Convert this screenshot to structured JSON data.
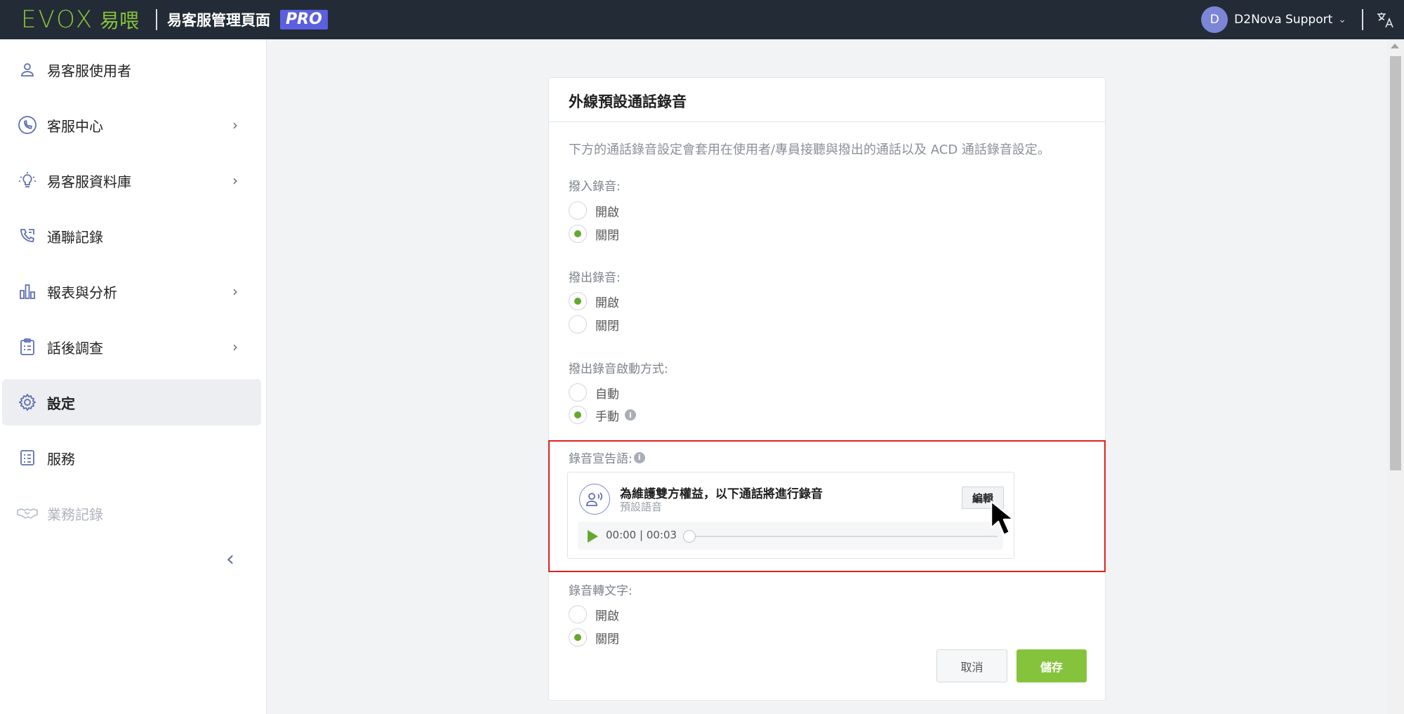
{
  "app": {
    "brand_logo_text": "EVOX",
    "brand_logo_cn": "易喂",
    "title": "易客服管理頁面",
    "badge": "PRO"
  },
  "user": {
    "avatar_letter": "D",
    "name": "D2Nova Support"
  },
  "sidebar": {
    "items": [
      {
        "label": "易客服使用者",
        "icon": "user-icon",
        "has_submenu": false
      },
      {
        "label": "客服中心",
        "icon": "call-center-icon",
        "has_submenu": true
      },
      {
        "label": "易客服資料庫",
        "icon": "lightbulb-icon",
        "has_submenu": true
      },
      {
        "label": "通聯記錄",
        "icon": "phone-log-icon",
        "has_submenu": false
      },
      {
        "label": "報表與分析",
        "icon": "bar-chart-icon",
        "has_submenu": true
      },
      {
        "label": "話後調查",
        "icon": "survey-icon",
        "has_submenu": true
      },
      {
        "label": "設定",
        "icon": "gear-icon",
        "has_submenu": false,
        "active": true
      },
      {
        "label": "服務",
        "icon": "service-list-icon",
        "has_submenu": false
      },
      {
        "label": "業務記錄",
        "icon": "handshake-icon",
        "has_submenu": false,
        "disabled": true
      }
    ]
  },
  "card": {
    "title": "外線預設通話錄音",
    "description": "下方的通話錄音設定會套用在使用者/專員接聽與撥出的通話以及 ACD 通話錄音設定。",
    "sections": {
      "inbound": {
        "label": "撥入錄音:",
        "options": [
          "開啟",
          "關閉"
        ],
        "selected": "關閉"
      },
      "outbound": {
        "label": "撥出錄音:",
        "options": [
          "開啟",
          "關閉"
        ],
        "selected": "開啟"
      },
      "outbound_mode": {
        "label": "撥出錄音啟動方式:",
        "options": [
          "自動",
          "手動"
        ],
        "selected": "手動"
      },
      "announcement": {
        "label": "錄音宣告語:",
        "title": "為維護雙方權益，以下通話將進行錄音",
        "subtitle": "預設語音",
        "edit_label": "編輯",
        "time": "00:00 | 00:03",
        "progress": 0
      },
      "transcription": {
        "label": "錄音轉文字:",
        "options": [
          "開啟",
          "關閉"
        ],
        "selected": "關閉"
      }
    },
    "cancel_label": "取消",
    "save_label": "儲存"
  },
  "colors": {
    "topbar": "#232b36",
    "brand_green": "#86c33c",
    "radio_green": "#64a82d",
    "icon_blue": "#5e6fb3",
    "pro_badge": "#5b5fe0",
    "highlight_red": "#e02020"
  }
}
